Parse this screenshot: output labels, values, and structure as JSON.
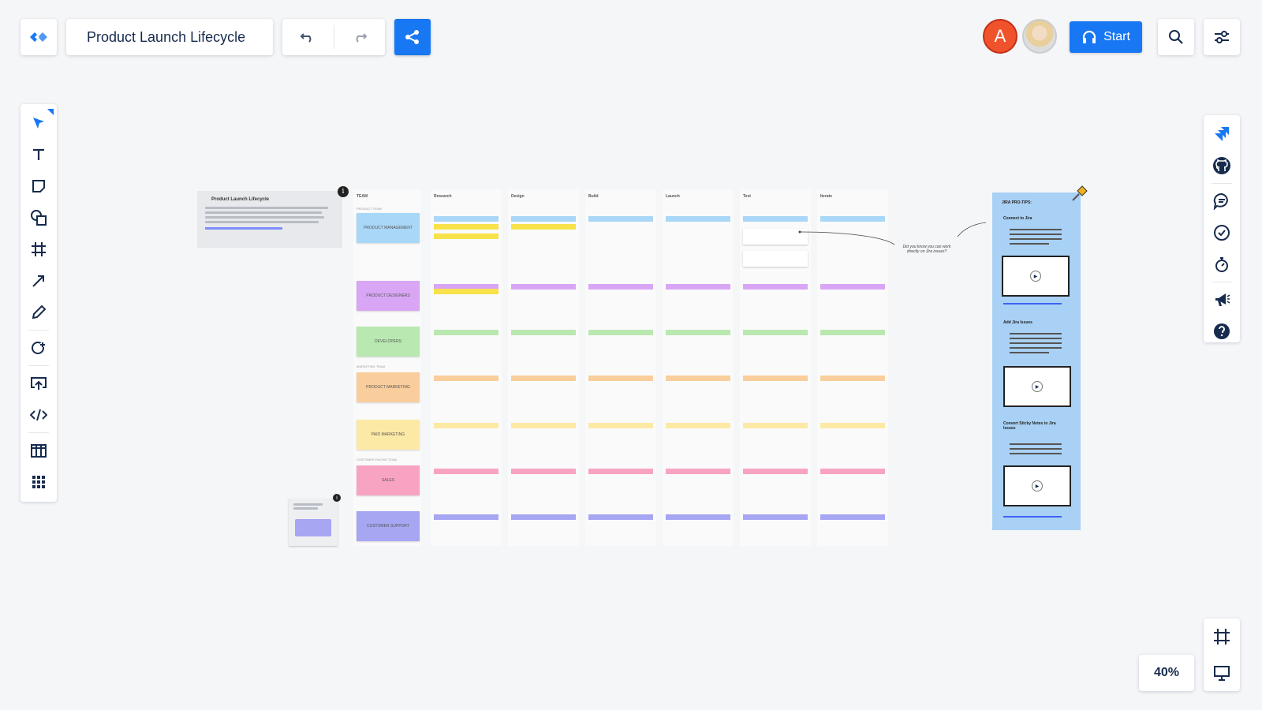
{
  "board": {
    "title": "Product Launch Lifecycle",
    "zoom": "40%"
  },
  "header": {
    "start_label": "Start",
    "avatar_initial": "A",
    "accent": "#1877f2"
  },
  "left_toolbar": [
    "select-tool",
    "text-tool",
    "sticky-note-tool",
    "shapes-tool",
    "frame-tool",
    "connector-tool",
    "pen-tool",
    "lasso-tool",
    "upload-tool",
    "embed-tool",
    "template-tool",
    "apps-tool"
  ],
  "right_toolbar": [
    "jira-icon",
    "github-icon",
    "comments-icon",
    "tasks-icon",
    "timer-icon",
    "announcement-icon",
    "help-icon"
  ],
  "canvas": {
    "intro": {
      "title": "Product Launch Lifecycle"
    },
    "columns": [
      "TEAM",
      "Research",
      "Design",
      "Build",
      "Launch",
      "Test",
      "Iterate"
    ],
    "sections": [
      "PRODUCT TEAM",
      "MARKETING TEAM",
      "CUSTOMER FACING TEAM"
    ],
    "teams": [
      "PRODUCT MANAGEMENT",
      "PRODUCT DESIGNERS",
      "DEVELOPERS",
      "PRODUCT MARKETING",
      "PAID MARKETING",
      "SALES",
      "CUSTOMER SUPPORT"
    ],
    "team_colors": [
      "#a9d7f7",
      "#d9a6f5",
      "#b9e8b0",
      "#f9ce9c",
      "#fde9a6",
      "#f9a3c3",
      "#a6a6f3"
    ],
    "hint": "Did you know you can work directly on Jira issues?",
    "jira_tips": {
      "title": "JIRA PRO-TIPS:",
      "steps": [
        "Connect to Jira",
        "Add Jira Issues",
        "Convert Sticky Notes to Jira Issues"
      ]
    }
  }
}
